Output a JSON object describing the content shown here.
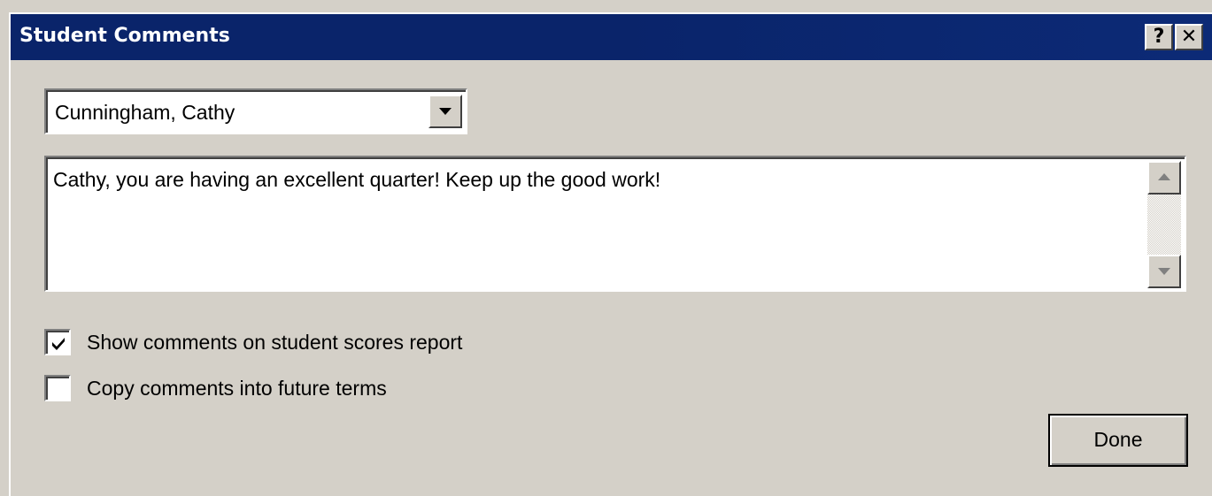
{
  "window": {
    "title": "Student Comments",
    "help_label": "?",
    "close_label": "✕"
  },
  "student_select": {
    "selected": "Cunningham, Cathy"
  },
  "comment": {
    "text": "Cathy, you are having an excellent quarter! Keep up the good work!"
  },
  "options": [
    {
      "label": "Show comments on student scores report",
      "checked": true
    },
    {
      "label": "Copy comments into future terms",
      "checked": false
    }
  ],
  "actions": {
    "done_label": "Done"
  },
  "colors": {
    "titlebar": "#0a246a",
    "face": "#d4d0c8"
  }
}
